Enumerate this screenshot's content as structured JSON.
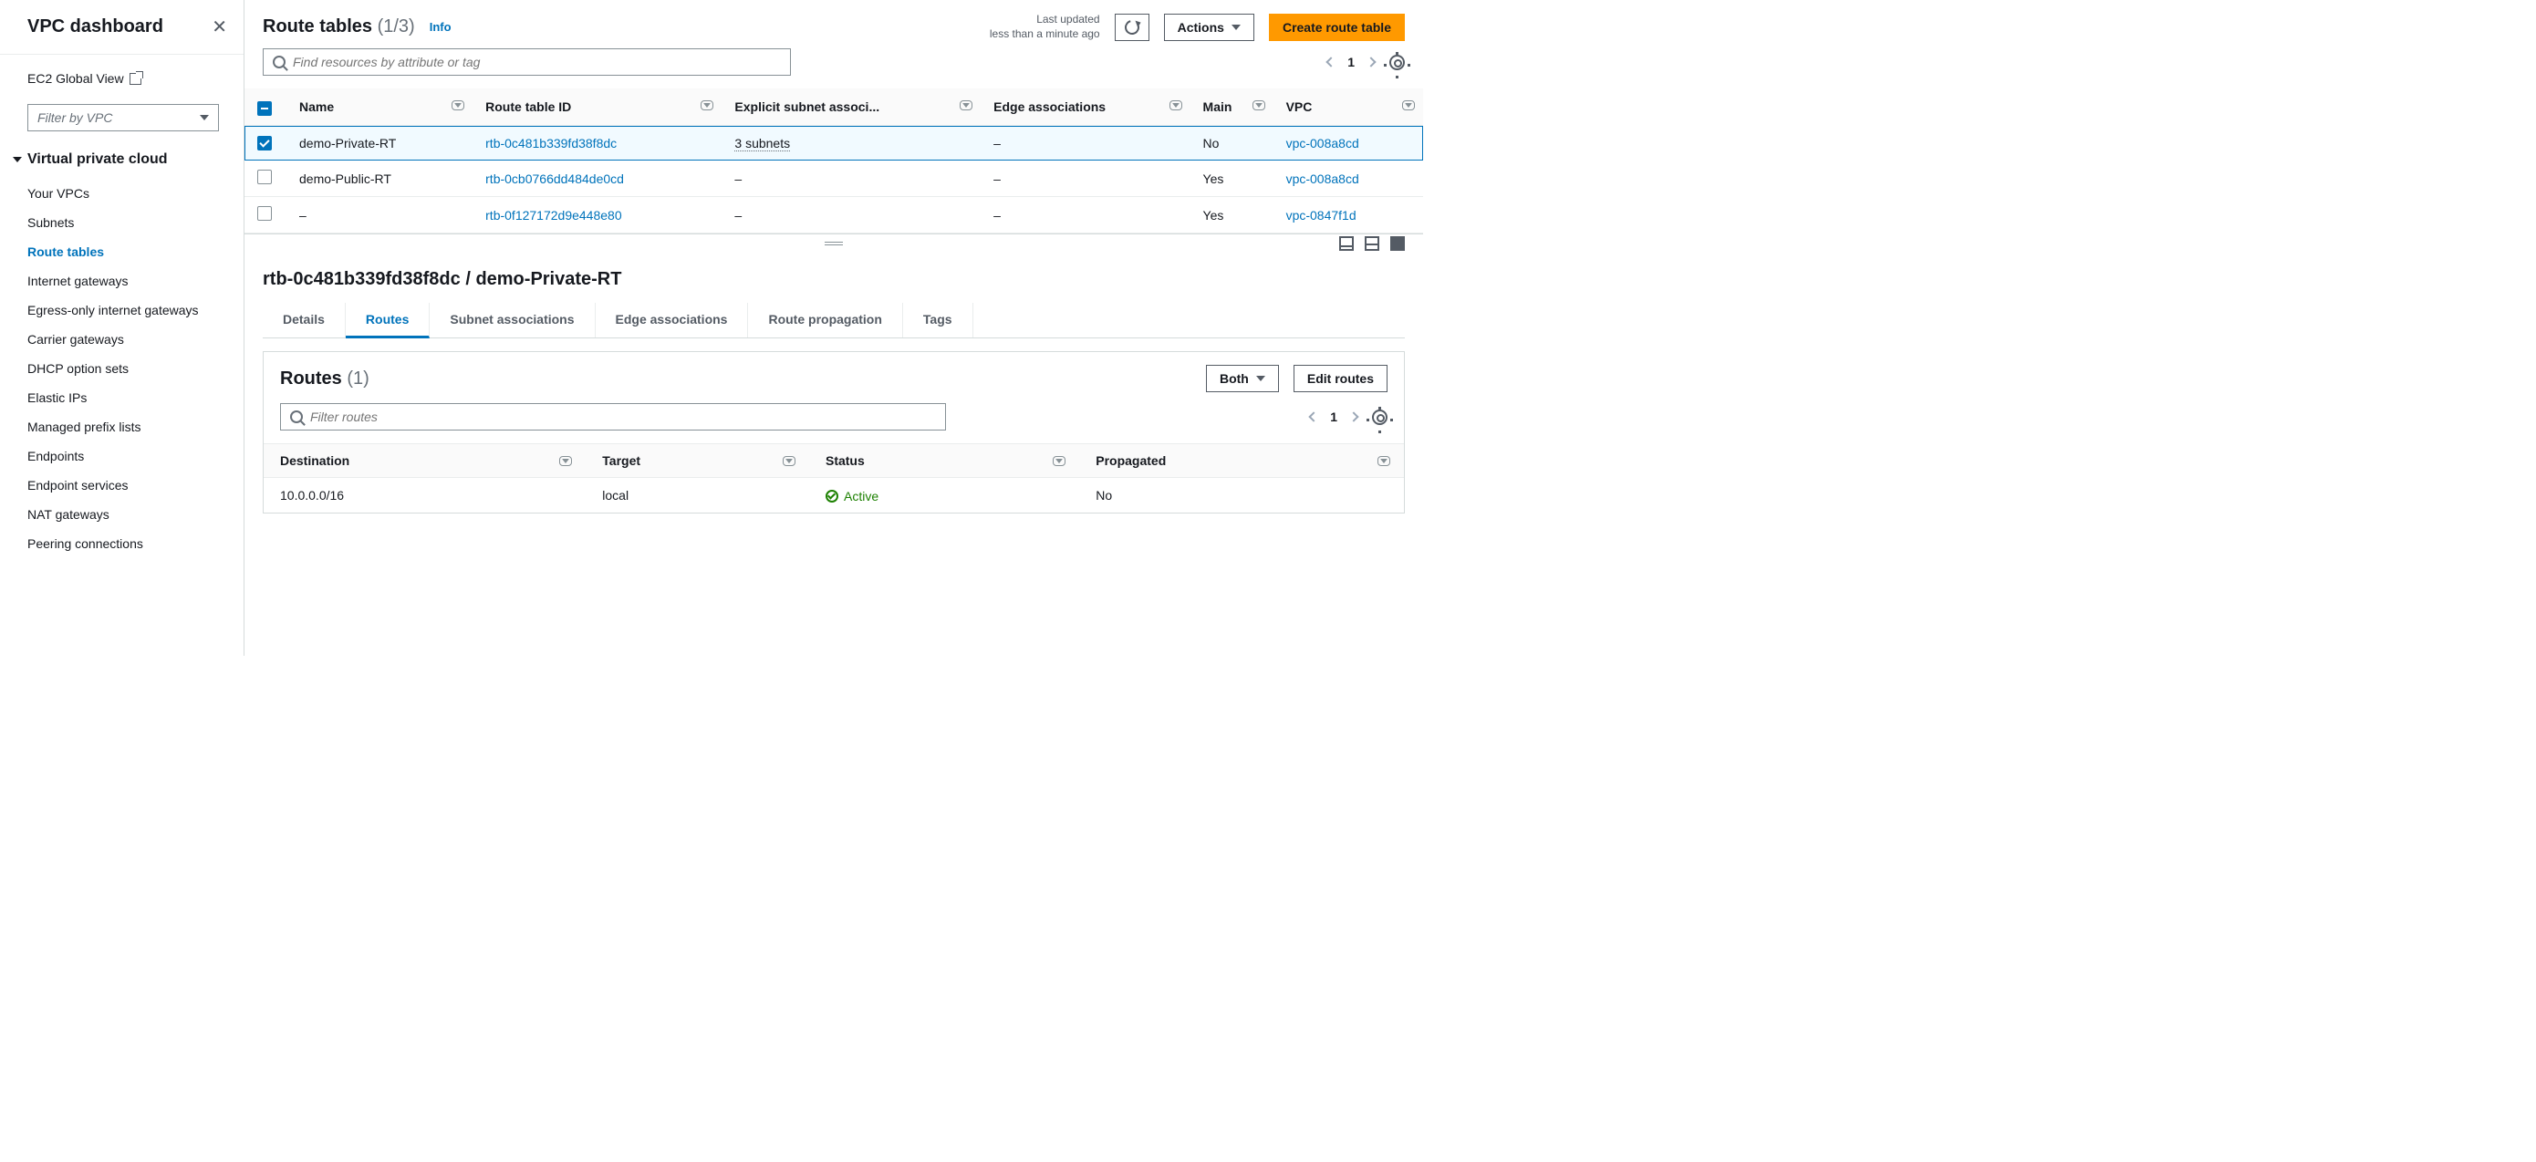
{
  "sidebar": {
    "title": "VPC dashboard",
    "ec2_link": "EC2 Global View",
    "filter_placeholder": "Filter by VPC",
    "section_title": "Virtual private cloud",
    "items": [
      "Your VPCs",
      "Subnets",
      "Route tables",
      "Internet gateways",
      "Egress-only internet gateways",
      "Carrier gateways",
      "DHCP option sets",
      "Elastic IPs",
      "Managed prefix lists",
      "Endpoints",
      "Endpoint services",
      "NAT gateways",
      "Peering connections"
    ],
    "active_index": 2
  },
  "header": {
    "title_prefix": "Route tables",
    "title_count": "(1/3)",
    "info": "Info",
    "last_updated_l1": "Last updated",
    "last_updated_l2": "less than a minute ago",
    "actions": "Actions",
    "create": "Create route table"
  },
  "search": {
    "placeholder": "Find resources by attribute or tag"
  },
  "pager": {
    "page": "1"
  },
  "table": {
    "columns": [
      "Name",
      "Route table ID",
      "Explicit subnet associ...",
      "Edge associations",
      "Main",
      "VPC"
    ],
    "rows": [
      {
        "selected": true,
        "name": "demo-Private-RT",
        "id": "rtb-0c481b339fd38f8dc",
        "subnets": "3 subnets",
        "edge": "–",
        "main": "No",
        "vpc": "vpc-008a8cd"
      },
      {
        "selected": false,
        "name": "demo-Public-RT",
        "id": "rtb-0cb0766dd484de0cd",
        "subnets": "–",
        "edge": "–",
        "main": "Yes",
        "vpc": "vpc-008a8cd"
      },
      {
        "selected": false,
        "name": "–",
        "id": "rtb-0f127172d9e448e80",
        "subnets": "–",
        "edge": "–",
        "main": "Yes",
        "vpc": "vpc-0847f1d"
      }
    ]
  },
  "detail": {
    "title": "rtb-0c481b339fd38f8dc / demo-Private-RT",
    "tabs": [
      "Details",
      "Routes",
      "Subnet associations",
      "Edge associations",
      "Route propagation",
      "Tags"
    ],
    "active_tab": 1
  },
  "routes": {
    "title": "Routes",
    "count": "(1)",
    "filter_label": "Both",
    "edit_label": "Edit routes",
    "search_placeholder": "Filter routes",
    "pager": "1",
    "columns": [
      "Destination",
      "Target",
      "Status",
      "Propagated"
    ],
    "rows": [
      {
        "dest": "10.0.0.0/16",
        "target": "local",
        "status": "Active",
        "propagated": "No"
      }
    ]
  }
}
